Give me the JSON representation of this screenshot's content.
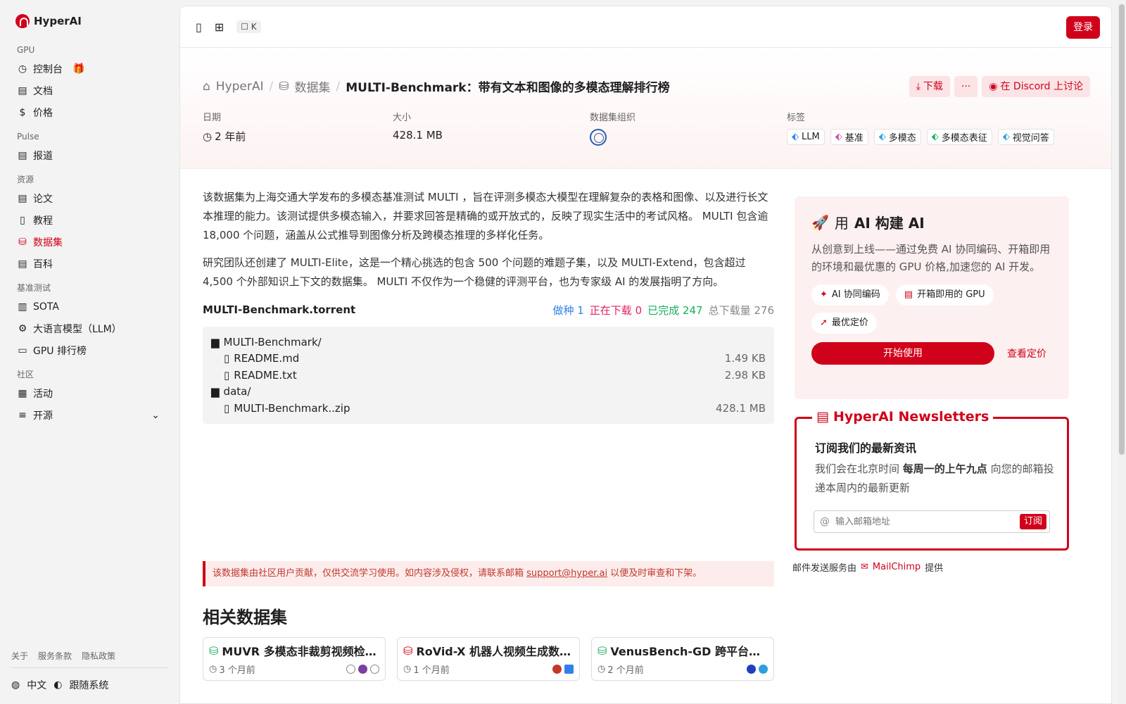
{
  "brand": {
    "name": "HyperAI"
  },
  "sidebar": {
    "sections": [
      {
        "title": "GPU",
        "items": [
          {
            "label": "控制台",
            "icon": "gauge-icon"
          },
          {
            "label": "文档",
            "icon": "doc-icon"
          },
          {
            "label": "价格",
            "icon": "dollar-icon"
          }
        ]
      },
      {
        "title": "Pulse",
        "items": [
          {
            "label": "报道",
            "icon": "news-icon"
          }
        ]
      },
      {
        "title": "资源",
        "items": [
          {
            "label": "论文",
            "icon": "paper-icon"
          },
          {
            "label": "教程",
            "icon": "book-icon"
          },
          {
            "label": "数据集",
            "icon": "database-icon"
          },
          {
            "label": "百科",
            "icon": "wiki-icon"
          }
        ]
      },
      {
        "title": "基准测试",
        "items": [
          {
            "label": "SOTA",
            "icon": "bar-chart-icon"
          },
          {
            "label": "大语言模型（LLM）",
            "icon": "chip-icon"
          },
          {
            "label": "GPU 排行榜",
            "icon": "monitor-icon"
          }
        ]
      },
      {
        "title": "社区",
        "items": [
          {
            "label": "活动",
            "icon": "calendar-icon"
          },
          {
            "label": "开源",
            "icon": "list-icon"
          }
        ]
      }
    ],
    "footer_links": [
      "关于",
      "服务条款",
      "隐私政策"
    ],
    "language": "中文",
    "theme": "跟随系统"
  },
  "topbar": {
    "shortcut": "K",
    "login": "登录"
  },
  "breadcrumb": {
    "home": "HyperAI",
    "section": "数据集",
    "current": "MULTI-Benchmark：带有文本和图像的多模态理解排行榜"
  },
  "actions": {
    "download": "下载",
    "more": "···",
    "discord": "在 Discord 上讨论"
  },
  "meta": {
    "date_label": "日期",
    "date_value": "2 年前",
    "size_label": "大小",
    "size_value": "428.1 MB",
    "org_label": "数据集组织",
    "tags_label": "标签",
    "tags": [
      "LLM",
      "基准",
      "多模态",
      "多模态表征",
      "视觉问答"
    ]
  },
  "description": {
    "p1": "该数据集为上海交通大学发布的多模态基准测试 MULTI ，旨在评测多模态大模型在理解复杂的表格和图像、以及进行长文本推理的能力。该测试提供多模态输入，并要求回答是精确的或开放式的，反映了现实生活中的考试风格。 MULTI 包含逾 18,000 个问题，涵盖从公式推导到图像分析及跨模态推理的多样化任务。",
    "p2": "研究团队还创建了 MULTI-Elite，这是一个精心挑选的包含 500 个问题的难题子集，以及 MULTI-Extend，包含超过 4,500 个外部知识上下文的数据集。 MULTI 不仅作为一个稳健的评测平台，也为专家级 AI 的发展指明了方向。"
  },
  "torrent": {
    "title": "MULTI-Benchmark.torrent",
    "seed_label": "做种",
    "seed": "1",
    "downloading_label": "正在下载",
    "downloading": "0",
    "done_label": "已完成",
    "done": "247",
    "total_label": "总下载量",
    "total": "276",
    "files": [
      {
        "name": "MULTI-Benchmark/",
        "type": "folder",
        "size": ""
      },
      {
        "name": "README.md",
        "type": "file",
        "size": "1.49 KB"
      },
      {
        "name": "README.txt",
        "type": "file",
        "size": "2.98 KB"
      },
      {
        "name": "data/",
        "type": "folder",
        "size": ""
      },
      {
        "name": "MULTI-Benchmark..zip",
        "type": "file",
        "size": "428.1 MB"
      }
    ]
  },
  "notice": {
    "text": "该数据集由社区用户贡献，仅供交流学习使用。如内容涉及侵权，请联系邮箱",
    "email": "support@hyper.ai",
    "suffix": "以便及时审查和下架。"
  },
  "related": {
    "title": "相关数据集",
    "items": [
      {
        "title": "MUVR 多模态非裁剪视频检索基准",
        "time": "3 个月前"
      },
      {
        "title": "RoVid-X 机器人视频生成数据集",
        "time": "1 个月前"
      },
      {
        "title": "VenusBench-GD 跨平台界面定位基准",
        "time": "2 个月前"
      }
    ]
  },
  "promo": {
    "title_prefix": "用",
    "title": "AI 构建 AI",
    "text": "从创意到上线——通过免费 AI 协同编码、开箱即用的环境和最优惠的 GPU 价格,加速您的 AI 开发。",
    "chips": [
      "AI 协同编码",
      "开箱即用的 GPU",
      "最优定价"
    ],
    "start": "开始使用",
    "pricing": "查看定价"
  },
  "newsletter": {
    "title": "HyperAI Newsletters",
    "heading": "订阅我们的最新资讯",
    "text_a": "我们会在北京时间",
    "text_b": "每周一的上午九点",
    "text_c": "向您的邮箱投递本周内的最新更新",
    "placeholder": "输入邮箱地址",
    "subscribe": "订阅",
    "by_prefix": "邮件发送服务由",
    "by_name": "MailChimp",
    "by_suffix": "提供"
  },
  "colors": {
    "accent": "#d0021b"
  }
}
